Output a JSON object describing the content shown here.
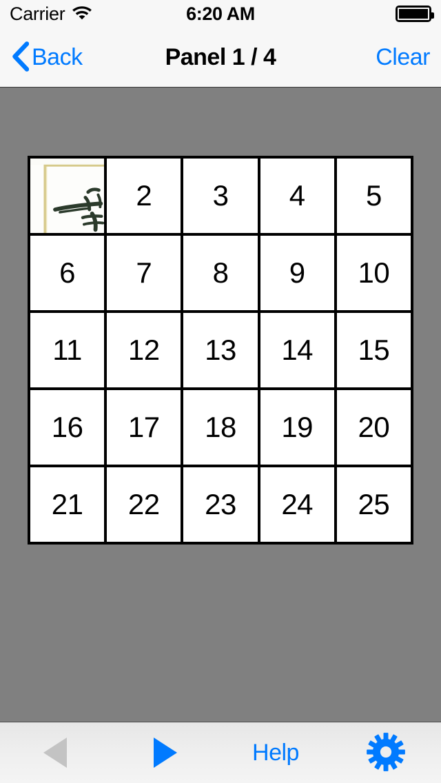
{
  "status_bar": {
    "carrier": "Carrier",
    "wifi_icon": "wifi-icon",
    "time": "6:20 AM",
    "battery_icon": "battery-full-icon"
  },
  "nav_bar": {
    "back_icon": "chevron-left-icon",
    "back_label": "Back",
    "title": "Panel 1 / 4",
    "clear_label": "Clear"
  },
  "colors": {
    "accent_blue": "#007aff",
    "disabled_gray": "#c3c3c3",
    "content_background": "#808080",
    "bar_background": "#f7f7f7",
    "tile_background": "#ffffff",
    "grid_line": "#000000",
    "photo_ink": "#2b3a2b",
    "photo_frame": "#d6c98a"
  },
  "puzzle": {
    "rows": 5,
    "columns": 5,
    "tiles": [
      {
        "id": 1,
        "label": "",
        "revealed": true
      },
      {
        "id": 2,
        "label": "2",
        "revealed": false
      },
      {
        "id": 3,
        "label": "3",
        "revealed": false
      },
      {
        "id": 4,
        "label": "4",
        "revealed": false
      },
      {
        "id": 5,
        "label": "5",
        "revealed": false
      },
      {
        "id": 6,
        "label": "6",
        "revealed": false
      },
      {
        "id": 7,
        "label": "7",
        "revealed": false
      },
      {
        "id": 8,
        "label": "8",
        "revealed": false
      },
      {
        "id": 9,
        "label": "9",
        "revealed": false
      },
      {
        "id": 10,
        "label": "10",
        "revealed": false
      },
      {
        "id": 11,
        "label": "11",
        "revealed": false
      },
      {
        "id": 12,
        "label": "12",
        "revealed": false
      },
      {
        "id": 13,
        "label": "13",
        "revealed": false
      },
      {
        "id": 14,
        "label": "14",
        "revealed": false
      },
      {
        "id": 15,
        "label": "15",
        "revealed": false
      },
      {
        "id": 16,
        "label": "16",
        "revealed": false
      },
      {
        "id": 17,
        "label": "17",
        "revealed": false
      },
      {
        "id": 18,
        "label": "18",
        "revealed": false
      },
      {
        "id": 19,
        "label": "19",
        "revealed": false
      },
      {
        "id": 20,
        "label": "20",
        "revealed": false
      },
      {
        "id": 21,
        "label": "21",
        "revealed": false
      },
      {
        "id": 22,
        "label": "22",
        "revealed": false
      },
      {
        "id": 23,
        "label": "23",
        "revealed": false
      },
      {
        "id": 24,
        "label": "24",
        "revealed": false
      },
      {
        "id": 25,
        "label": "25",
        "revealed": false
      }
    ]
  },
  "toolbar": {
    "prev_icon": "triangle-left-icon",
    "prev_enabled": false,
    "next_icon": "triangle-right-icon",
    "next_enabled": true,
    "help_label": "Help",
    "settings_icon": "gear-icon"
  }
}
